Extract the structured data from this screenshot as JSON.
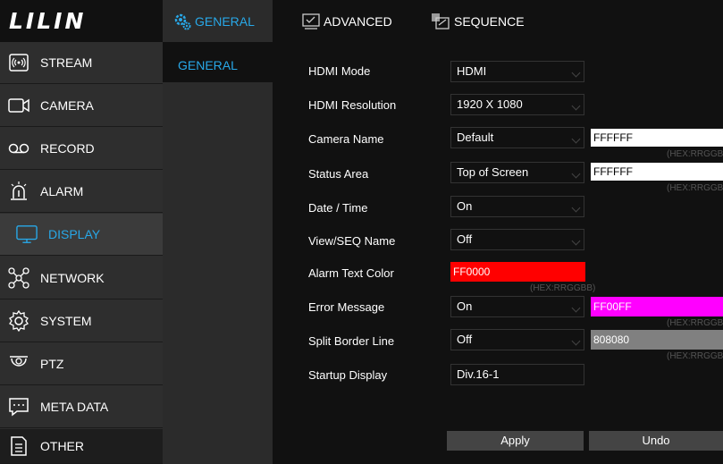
{
  "logo": "LILIN",
  "sidebar": {
    "items": [
      {
        "label": "STREAM",
        "icon": "stream-icon"
      },
      {
        "label": "CAMERA",
        "icon": "camera-icon"
      },
      {
        "label": "RECORD",
        "icon": "record-icon"
      },
      {
        "label": "ALARM",
        "icon": "alarm-icon"
      },
      {
        "label": "DISPLAY",
        "icon": "display-icon"
      },
      {
        "label": "NETWORK",
        "icon": "network-icon"
      },
      {
        "label": "SYSTEM",
        "icon": "system-gear-icon"
      },
      {
        "label": "PTZ",
        "icon": "ptz-camera-icon"
      },
      {
        "label": "META DATA",
        "icon": "meta-data-icon"
      },
      {
        "label": "OTHER",
        "icon": "other-document-icon"
      }
    ],
    "active": "DISPLAY"
  },
  "tabs": {
    "general": "GENERAL",
    "advanced": "ADVANCED",
    "sequence": "SEQUENCE"
  },
  "subnav": {
    "general": "GENERAL"
  },
  "form": {
    "hdmi_mode": {
      "label": "HDMI Mode",
      "value": "HDMI"
    },
    "hdmi_resolution": {
      "label": "HDMI Resolution",
      "value": "1920 X 1080"
    },
    "camera_name": {
      "label": "Camera Name",
      "value": "Default",
      "hex": "FFFFFF",
      "hex_note": "(HEX:RRGGBB)"
    },
    "status_area": {
      "label": "Status Area",
      "value": "Top of Screen",
      "hex": "FFFFFF",
      "hex_note": "(HEX:RRGGBB)"
    },
    "date_time": {
      "label": "Date / Time",
      "value": "On"
    },
    "view_seq_name": {
      "label": "View/SEQ Name",
      "value": "Off"
    },
    "alarm_text_color": {
      "label": "Alarm Text Color",
      "hex": "FF0000",
      "hex_note": "(HEX:RRGGBB)"
    },
    "error_message": {
      "label": "Error Message",
      "value": "On",
      "hex": "FF00FF",
      "hex_note": "(HEX:RRGGBB)"
    },
    "split_border_line": {
      "label": "Split Border Line",
      "value": "Off",
      "hex": "808080",
      "hex_note": "(HEX:RRGGBB)"
    },
    "startup_display": {
      "label": "Startup Display",
      "value": "Div.16-1"
    }
  },
  "buttons": {
    "apply": "Apply",
    "undo": "Undo"
  },
  "colors": {
    "accent": "#28a8e8",
    "alarm": "#ff0000",
    "error": "#ff00ff",
    "border_line": "#808080"
  }
}
